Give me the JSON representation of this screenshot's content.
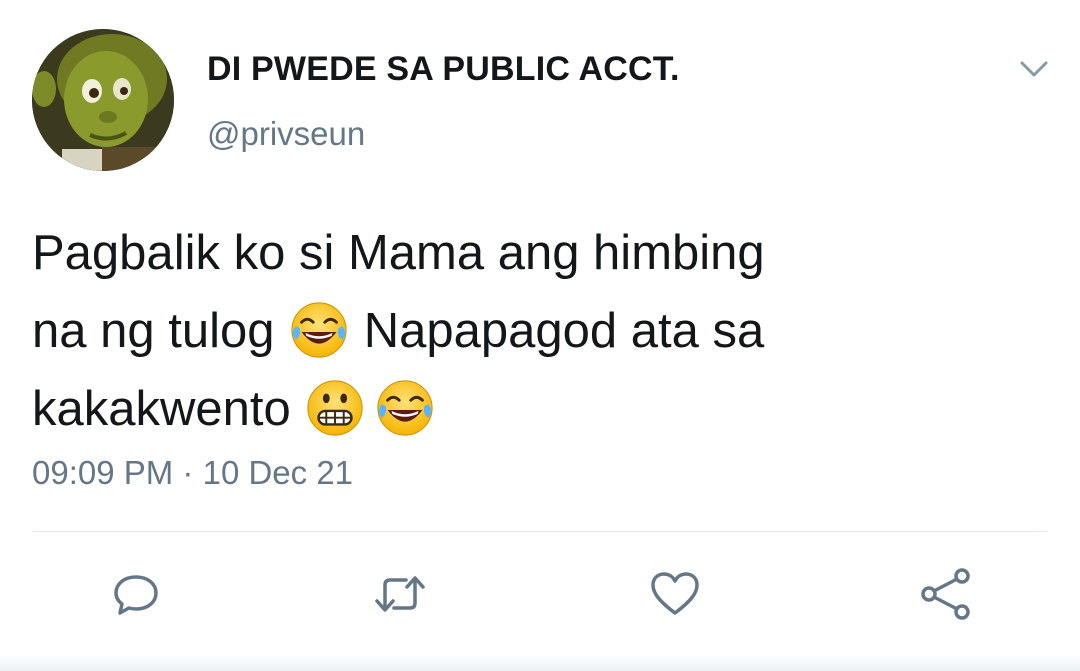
{
  "tweet": {
    "display_name": "DI PWEDE SA PUBLIC ACCT.",
    "handle": "@privseun",
    "text_lines": {
      "line1": "Pagbalik ko si Mama ang himbing",
      "line2_a": "na ng tulog",
      "line2_b": "Napapagod ata sa",
      "line3": "kakakwento"
    },
    "emojis": [
      "face-with-tears-of-joy",
      "grimacing-face",
      "face-with-tears-of-joy"
    ],
    "time": "09:09 PM",
    "separator": "·",
    "date": "10 Dec 21"
  },
  "icons": {
    "menu": "chevron-down-icon",
    "reply": "reply-icon",
    "retweet": "retweet-icon",
    "like": "heart-icon",
    "share": "share-icon"
  },
  "colors": {
    "text": "#14171a",
    "secondary": "#657786",
    "divider": "#e1e8ed"
  }
}
